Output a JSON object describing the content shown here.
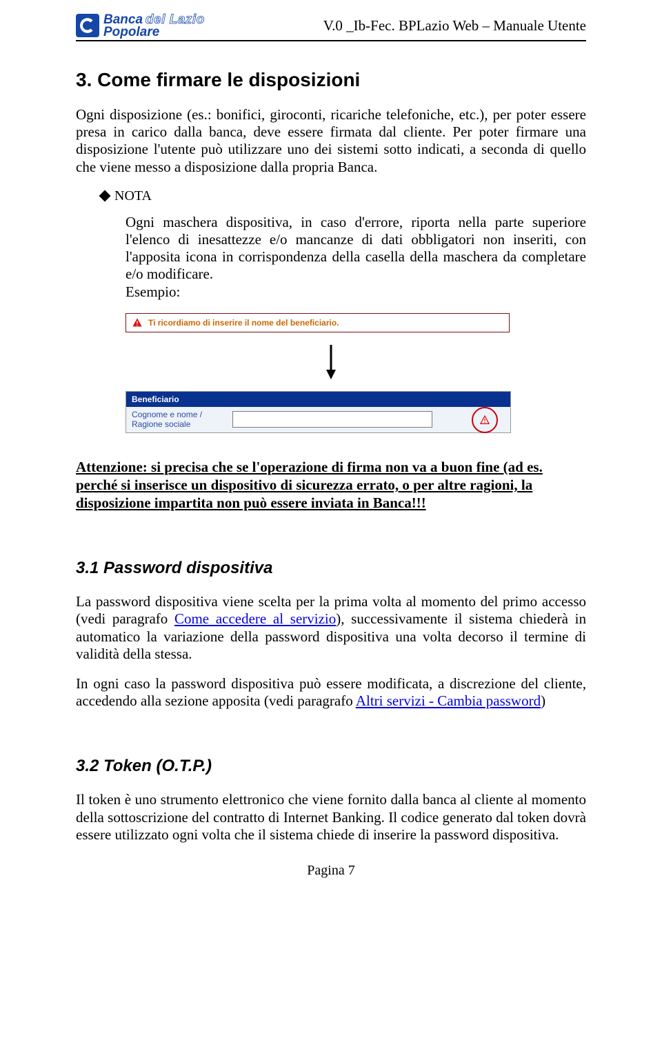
{
  "header": {
    "logo_line1_a": "Banca",
    "logo_line1_b": "del Lazio",
    "logo_line2": "Popolare",
    "doc_title": "V.0 _Ib-Fec. BPLazio Web – Manuale Utente"
  },
  "section3": {
    "title": "3.    Come firmare le disposizioni",
    "para1": "Ogni disposizione (es.: bonifici, giroconti, ricariche telefoniche, etc.), per poter essere presa in carico dalla banca, deve essere firmata dal cliente. Per poter firmare una disposizione l'utente può utilizzare uno dei sistemi sotto indicati, a seconda di quello che viene messo a disposizione dalla propria Banca.",
    "nota_label": "NOTA",
    "nota_body": "Ogni maschera dispositiva, in caso d'errore, riporta nella parte superiore l'elenco di inesattezze e/o mancanze di dati obbligatori non inseriti, con l'apposita icona in corrispondenza della casella della maschera da completare e/o modificare.",
    "nota_esempio": "Esempio:",
    "warning_msg": "Ti ricordiamo di inserire il nome del beneficiario.",
    "benef_header": "Beneficiario",
    "benef_label": "Cognome e nome / Ragione sociale",
    "benef_value": "",
    "attention": "Attenzione: si precisa che se l'operazione di firma non va a buon fine (ad es. perché si inserisce un dispositivo di sicurezza errato, o per altre ragioni, la disposizione impartita non può essere inviata in Banca!!!"
  },
  "section31": {
    "title": "3.1    Password dispositiva",
    "para_a": "La password dispositiva viene scelta per la prima volta al momento del primo accesso (vedi paragrafo ",
    "link1": "Come accedere al servizio",
    "para_b": "), successivamente il sistema chiederà in automatico la variazione della password dispositiva una volta decorso il termine di validità della stessa.",
    "para2_a": "In ogni caso la password dispositiva può essere modificata, a discrezione del cliente, accedendo alla sezione apposita (vedi paragrafo ",
    "link2": "Altri servizi - Cambia password",
    "para2_b": ")"
  },
  "section32": {
    "title": "3.2    Token (O.T.P.)",
    "para": "Il token è uno strumento elettronico che viene fornito dalla banca al cliente al momento della sottoscrizione del contratto di Internet Banking. Il codice generato dal token dovrà essere utilizzato ogni volta che il sistema chiede di inserire la password dispositiva."
  },
  "footer": {
    "page": "Pagina 7"
  }
}
